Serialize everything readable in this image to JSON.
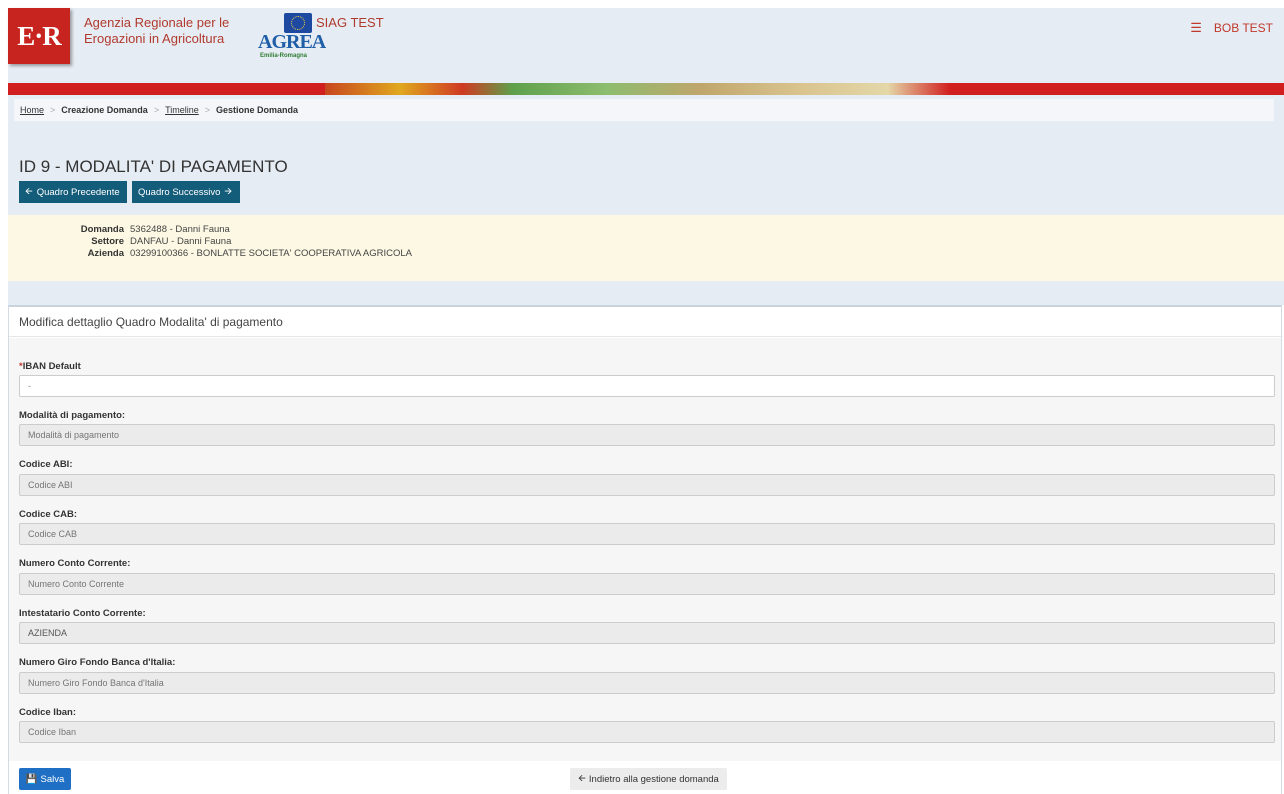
{
  "header": {
    "logo_text": "E·R",
    "agency_line1": "Agenzia Regionale per le",
    "agency_line2": "Erogazioni in Agricoltura",
    "agrea_logo_text": "AGREA",
    "agrea_logo_sub": "Emilia-Romagna",
    "system_name": "SIAG TEST",
    "user_name": "BOB TEST",
    "menu_icon": "hamburger-icon"
  },
  "breadcrumb": {
    "items": [
      "Home",
      "Creazione Domanda",
      "Timeline",
      "Gestione Domanda"
    ],
    "separator": ">"
  },
  "page": {
    "title": "ID 9 - MODALITA' DI PAGAMENTO",
    "prev_button": "Quadro Precedente",
    "next_button": "Quadro Successivo"
  },
  "info": {
    "domanda_label": "Domanda",
    "domanda_value": "5362488 - Danni Fauna",
    "settore_label": "Settore",
    "settore_value": "DANFAU - Danni Fauna",
    "azienda_label": "Azienda",
    "azienda_value": "03299100366 - BONLATTE SOCIETA' COOPERATIVA AGRICOLA"
  },
  "panel": {
    "title": "Modifica dettaglio Quadro Modalita' di pagamento",
    "fields": [
      {
        "required": "*",
        "label": "IBAN Default",
        "value": "-"
      },
      {
        "label": "Modalità di pagamento:",
        "placeholder": "Modalità di pagamento"
      },
      {
        "label": "Codice ABI:",
        "placeholder": "Codice ABI"
      },
      {
        "label": "Codice CAB:",
        "placeholder": "Codice CAB"
      },
      {
        "label": "Numero Conto Corrente:",
        "placeholder": "Numero Conto Corrente"
      },
      {
        "label": "Intestatario Conto Corrente:",
        "value": "AZIENDA"
      },
      {
        "label": "Numero Giro Fondo Banca d'Italia:",
        "placeholder": "Numero Giro Fondo Banca d'Italia"
      },
      {
        "label": "Codice Iban:",
        "placeholder": "Codice Iban"
      }
    ],
    "save_button": "Salva",
    "back_button": "Indietro alla gestione domanda"
  },
  "colors": {
    "brand_red": "#c8241f",
    "nav_button": "#135c7a",
    "save_button": "#1f6fc4",
    "info_bg": "#fcf8e3"
  }
}
